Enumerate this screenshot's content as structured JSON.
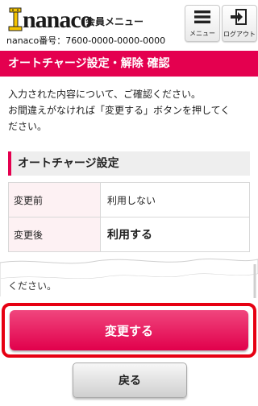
{
  "header": {
    "logo_text": "nanaco",
    "menu_title": "会員メニュー",
    "card_number": "nanaco番号：7600-0000-0000-0000",
    "menu_button_label": "メニュー",
    "logout_button_label": "ログアウト"
  },
  "page": {
    "title": "オートチャージ設定・解除 確認",
    "intro_line1": "入力された内容について、ご確認ください。",
    "intro_line2": "お間違えがなければ「変更する」ボタンを押してく",
    "intro_line3": "ださい。",
    "repeated_fragment": "ください。"
  },
  "section": {
    "heading": "オートチャージ設定",
    "rows": [
      {
        "label": "変更前",
        "value": "利用しない"
      },
      {
        "label": "変更後",
        "value": "利用する"
      }
    ]
  },
  "buttons": {
    "confirm_label": "変更する",
    "back_label": "戻る"
  },
  "colors": {
    "accent": "#e4004f",
    "highlight": "#e60012"
  }
}
